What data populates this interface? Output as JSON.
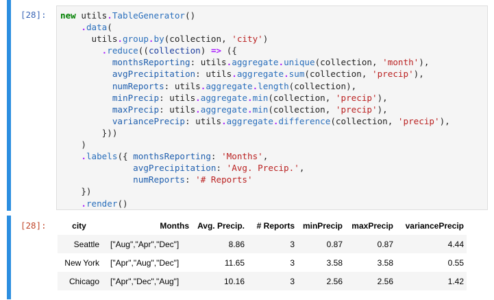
{
  "input_cell": {
    "prompt": "[28]:",
    "code_lines": [
      [
        {
          "t": "new",
          "c": "kw"
        },
        {
          "t": " utils"
        },
        {
          "t": ".",
          "c": "op"
        },
        {
          "t": "TableGenerator",
          "c": "fn"
        },
        {
          "t": "()"
        }
      ],
      [
        {
          "t": "    "
        },
        {
          "t": ".",
          "c": "op"
        },
        {
          "t": "data",
          "c": "fn"
        },
        {
          "t": "("
        }
      ],
      [
        {
          "t": "      utils"
        },
        {
          "t": ".",
          "c": "op"
        },
        {
          "t": "group",
          "c": "fn"
        },
        {
          "t": ".",
          "c": "op"
        },
        {
          "t": "by",
          "c": "fn"
        },
        {
          "t": "(collection, "
        },
        {
          "t": "'city'",
          "c": "str"
        },
        {
          "t": ")"
        }
      ],
      [
        {
          "t": "        "
        },
        {
          "t": ".",
          "c": "op"
        },
        {
          "t": "reduce",
          "c": "fn"
        },
        {
          "t": "(("
        },
        {
          "t": "collection",
          "c": "arg"
        },
        {
          "t": ") "
        },
        {
          "t": "=>",
          "c": "op"
        },
        {
          "t": " ({"
        }
      ],
      [
        {
          "t": "          "
        },
        {
          "t": "monthsReporting",
          "c": "prop"
        },
        {
          "t": ": utils"
        },
        {
          "t": ".",
          "c": "op"
        },
        {
          "t": "aggregate",
          "c": "fn"
        },
        {
          "t": ".",
          "c": "op"
        },
        {
          "t": "unique",
          "c": "fn"
        },
        {
          "t": "(collection, "
        },
        {
          "t": "'month'",
          "c": "str"
        },
        {
          "t": "),"
        }
      ],
      [
        {
          "t": "          "
        },
        {
          "t": "avgPrecipitation",
          "c": "prop"
        },
        {
          "t": ": utils"
        },
        {
          "t": ".",
          "c": "op"
        },
        {
          "t": "aggregate",
          "c": "fn"
        },
        {
          "t": ".",
          "c": "op"
        },
        {
          "t": "sum",
          "c": "fn"
        },
        {
          "t": "(collection, "
        },
        {
          "t": "'precip'",
          "c": "str"
        },
        {
          "t": "),"
        }
      ],
      [
        {
          "t": "          "
        },
        {
          "t": "numReports",
          "c": "prop"
        },
        {
          "t": ": utils"
        },
        {
          "t": ".",
          "c": "op"
        },
        {
          "t": "aggregate",
          "c": "fn"
        },
        {
          "t": ".",
          "c": "op"
        },
        {
          "t": "length",
          "c": "fn"
        },
        {
          "t": "(collection),"
        }
      ],
      [
        {
          "t": "          "
        },
        {
          "t": "minPrecip",
          "c": "prop"
        },
        {
          "t": ": utils"
        },
        {
          "t": ".",
          "c": "op"
        },
        {
          "t": "aggregate",
          "c": "fn"
        },
        {
          "t": ".",
          "c": "op"
        },
        {
          "t": "min",
          "c": "fn"
        },
        {
          "t": "(collection, "
        },
        {
          "t": "'precip'",
          "c": "str"
        },
        {
          "t": "),"
        }
      ],
      [
        {
          "t": "          "
        },
        {
          "t": "maxPrecip",
          "c": "prop"
        },
        {
          "t": ": utils"
        },
        {
          "t": ".",
          "c": "op"
        },
        {
          "t": "aggregate",
          "c": "fn"
        },
        {
          "t": ".",
          "c": "op"
        },
        {
          "t": "min",
          "c": "fn"
        },
        {
          "t": "(collection, "
        },
        {
          "t": "'precip'",
          "c": "str"
        },
        {
          "t": "),"
        }
      ],
      [
        {
          "t": "          "
        },
        {
          "t": "variancePrecip",
          "c": "prop"
        },
        {
          "t": ": utils"
        },
        {
          "t": ".",
          "c": "op"
        },
        {
          "t": "aggregate",
          "c": "fn"
        },
        {
          "t": ".",
          "c": "op"
        },
        {
          "t": "difference",
          "c": "fn"
        },
        {
          "t": "(collection, "
        },
        {
          "t": "'precip'",
          "c": "str"
        },
        {
          "t": "),"
        }
      ],
      [
        {
          "t": "        }))"
        }
      ],
      [
        {
          "t": "    )"
        }
      ],
      [
        {
          "t": "    "
        },
        {
          "t": ".",
          "c": "op"
        },
        {
          "t": "labels",
          "c": "fn"
        },
        {
          "t": "({ "
        },
        {
          "t": "monthsReporting",
          "c": "prop"
        },
        {
          "t": ": "
        },
        {
          "t": "'Months'",
          "c": "str"
        },
        {
          "t": ","
        }
      ],
      [
        {
          "t": "              "
        },
        {
          "t": "avgPrecipitation",
          "c": "prop"
        },
        {
          "t": ": "
        },
        {
          "t": "'Avg. Precip.'",
          "c": "str"
        },
        {
          "t": ","
        }
      ],
      [
        {
          "t": "              "
        },
        {
          "t": "numReports",
          "c": "prop"
        },
        {
          "t": ": "
        },
        {
          "t": "'# Reports'",
          "c": "str"
        }
      ],
      [
        {
          "t": "    })"
        }
      ],
      [
        {
          "t": "    "
        },
        {
          "t": ".",
          "c": "op"
        },
        {
          "t": "render",
          "c": "fn"
        },
        {
          "t": "()"
        }
      ]
    ]
  },
  "output_cell": {
    "prompt": "[28]:",
    "table": {
      "headers": [
        "city",
        "Months",
        "Avg. Precip.",
        "# Reports",
        "minPrecip",
        "maxPrecip",
        "variancePrecip"
      ],
      "rows": [
        [
          "Seattle",
          "[\"Aug\",\"Apr\",\"Dec\"]",
          "8.86",
          "3",
          "0.87",
          "0.87",
          "4.44"
        ],
        [
          "New York",
          "[\"Apr\",\"Aug\",\"Dec\"]",
          "11.65",
          "3",
          "3.58",
          "3.58",
          "0.55"
        ],
        [
          "Chicago",
          "[\"Apr\",\"Dec\",\"Aug\"]",
          "10.16",
          "3",
          "2.56",
          "2.56",
          "1.42"
        ]
      ]
    }
  },
  "colors": {
    "cell_selection_bar": "#2c8ee0",
    "input_prompt": "#3a66b6",
    "output_prompt": "#c0462a",
    "keyword": "#008000",
    "string": "#ba2121",
    "operator": "#aa22ff",
    "function": "#2a6fbc"
  }
}
